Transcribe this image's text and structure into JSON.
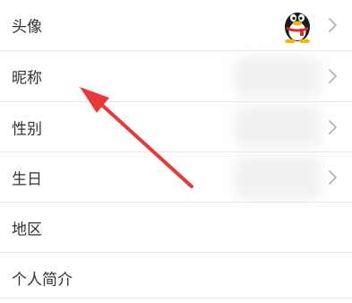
{
  "profile_fields": [
    {
      "label": "头像"
    },
    {
      "label": "昵称"
    },
    {
      "label": "性别"
    },
    {
      "label": "生日"
    },
    {
      "label": "地区"
    },
    {
      "label": "个人简介"
    }
  ],
  "icons": {
    "avatar": "qq-penguin-icon",
    "chevron": "chevron-right-icon",
    "annotation": "red-arrow-annotation"
  },
  "colors": {
    "text": "#333333",
    "divider": "#e7e7e7",
    "chevron": "#b2b2b2",
    "annotation_arrow": "#e8393a"
  }
}
